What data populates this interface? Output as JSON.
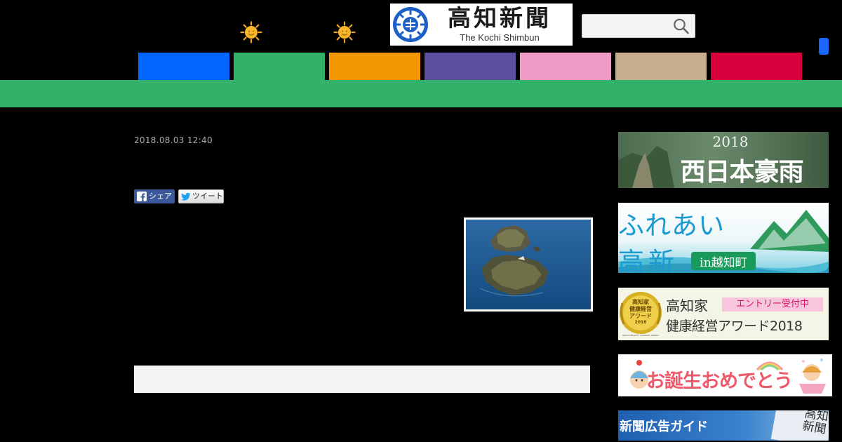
{
  "header": {
    "logo": {
      "name_kanji": "高知新聞",
      "name_roman": "The Kochi Shimbun"
    },
    "weather_icons": [
      "sun-icon",
      "sun-icon"
    ],
    "search": {
      "value": "",
      "icon": "search-icon"
    },
    "menu_icon": "menu-icon"
  },
  "nav": {
    "tabs": [
      {
        "color": "#0066ff"
      },
      {
        "color": "#33b06a",
        "active": true
      },
      {
        "color": "#f39800"
      },
      {
        "color": "#5e4ea0"
      },
      {
        "color": "#ee9bc6"
      },
      {
        "color": "#c8ae8c"
      },
      {
        "color": "#d5003c"
      }
    ],
    "active_band_color": "#33b06a"
  },
  "article": {
    "datetime": "2018.08.03 12:40",
    "share": {
      "facebook_label": "シェア",
      "twitter_label": "ツイート"
    },
    "photo": {
      "subject": "rocky islands in the sea (aerial photo)"
    }
  },
  "sidebar": {
    "banners": [
      {
        "year": "2018",
        "title": "西日本豪雨"
      },
      {
        "line1": "ふれあい",
        "line2": "高新",
        "place": "in越知町"
      },
      {
        "badge_line1": "高知家",
        "badge_line2": "健康経営",
        "badge_line3": "アワード",
        "badge_year": "2018",
        "badge_caption": "KOCHI HEALTHY COMPANY AWARD",
        "title_line1": "高知家",
        "entry_tag": "エントリー受付中",
        "title_line2": "健康経営アワード2018"
      },
      {
        "title": "お誕生おめでとう"
      },
      {
        "title": "新聞広告ガイド",
        "newspaper_text": "高知新聞"
      }
    ]
  }
}
